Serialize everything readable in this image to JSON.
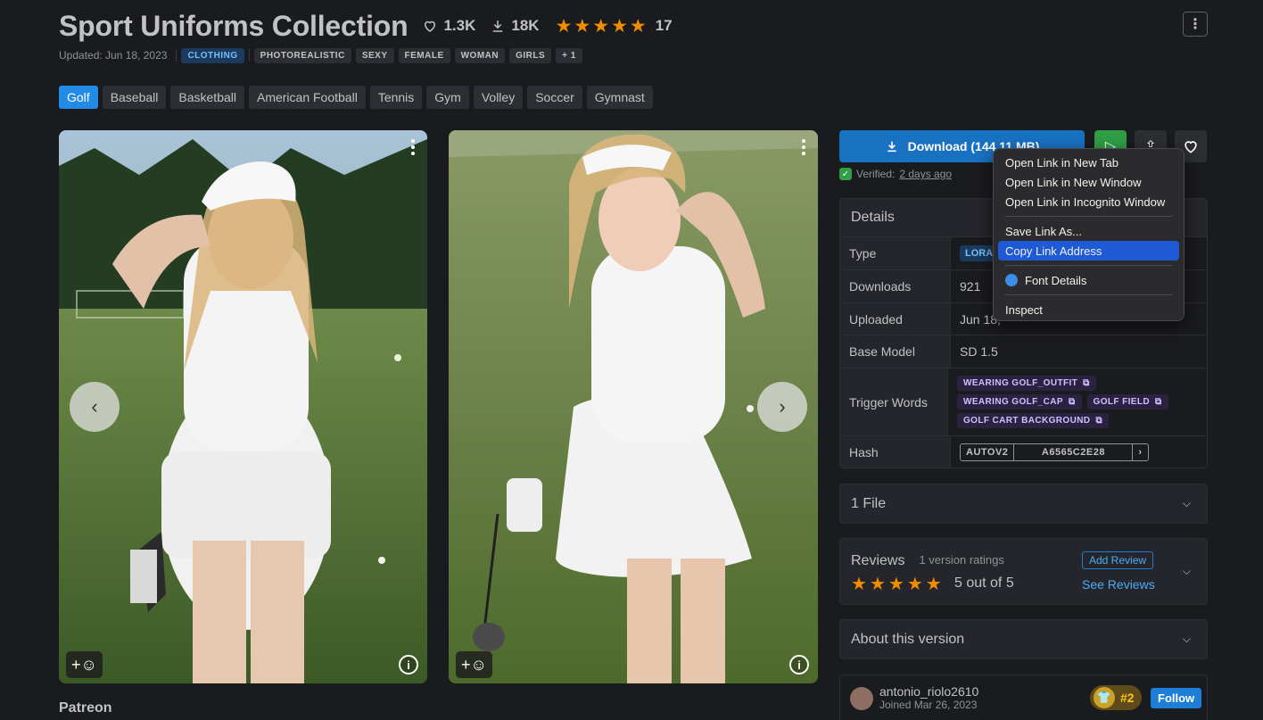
{
  "header": {
    "title": "Sport Uniforms Collection",
    "likes": "1.3K",
    "downloads": "18K",
    "rating_count": "17",
    "stars": 5
  },
  "meta": {
    "updated": "Updated: Jun 18, 2023",
    "tags": [
      "CLOTHING",
      "PHOTOREALISTIC",
      "SEXY",
      "FEMALE",
      "WOMAN",
      "GIRLS",
      "+ 1"
    ]
  },
  "categories": [
    "Golf",
    "Baseball",
    "Basketball",
    "American Football",
    "Tennis",
    "Gym",
    "Volley",
    "Soccer",
    "Gymnast"
  ],
  "gallery": {
    "reaction": "+☺",
    "info": "i"
  },
  "patreon_label": "Patreon",
  "sidebar": {
    "download_label": "Download (144.11 MB)",
    "verified_prefix": "Verified:",
    "verified_when": "2 days ago",
    "details_title": "Details",
    "rows": {
      "type_label": "Type",
      "type_value": "LORA",
      "downloads_label": "Downloads",
      "downloads_value": "921",
      "uploaded_label": "Uploaded",
      "uploaded_value": "Jun 18,",
      "base_label": "Base Model",
      "base_value": "SD 1.5",
      "trigger_label": "Trigger Words",
      "triggers": [
        "WEARING GOLF_OUTFIT",
        "WEARING GOLF_CAP",
        "GOLF FIELD",
        "GOLF CART BACKGROUND"
      ],
      "hash_label": "Hash",
      "hash_type": "AUTOV2",
      "hash_value": "A6565C2E28"
    },
    "files_title": "1 File",
    "reviews_title": "Reviews",
    "reviews_sub": "1 version ratings",
    "add_review": "Add Review",
    "see_reviews": "See Reviews",
    "score": "5 out of 5",
    "about_title": "About this version",
    "user": {
      "name": "antonio_riolo2610",
      "joined": "Joined Mar 26, 2023",
      "rank": "#2",
      "follow": "Follow"
    }
  },
  "context_menu": {
    "items": [
      "Open Link in New Tab",
      "Open Link in New Window",
      "Open Link in Incognito Window",
      "Save Link As...",
      "Copy Link Address",
      "Font Details",
      "Inspect"
    ],
    "highlighted": "Copy Link Address"
  },
  "colors": {
    "accent": "#228be6",
    "star": "#f08c00",
    "verified": "#2f9e44",
    "highlight": "#1e5ad6"
  }
}
